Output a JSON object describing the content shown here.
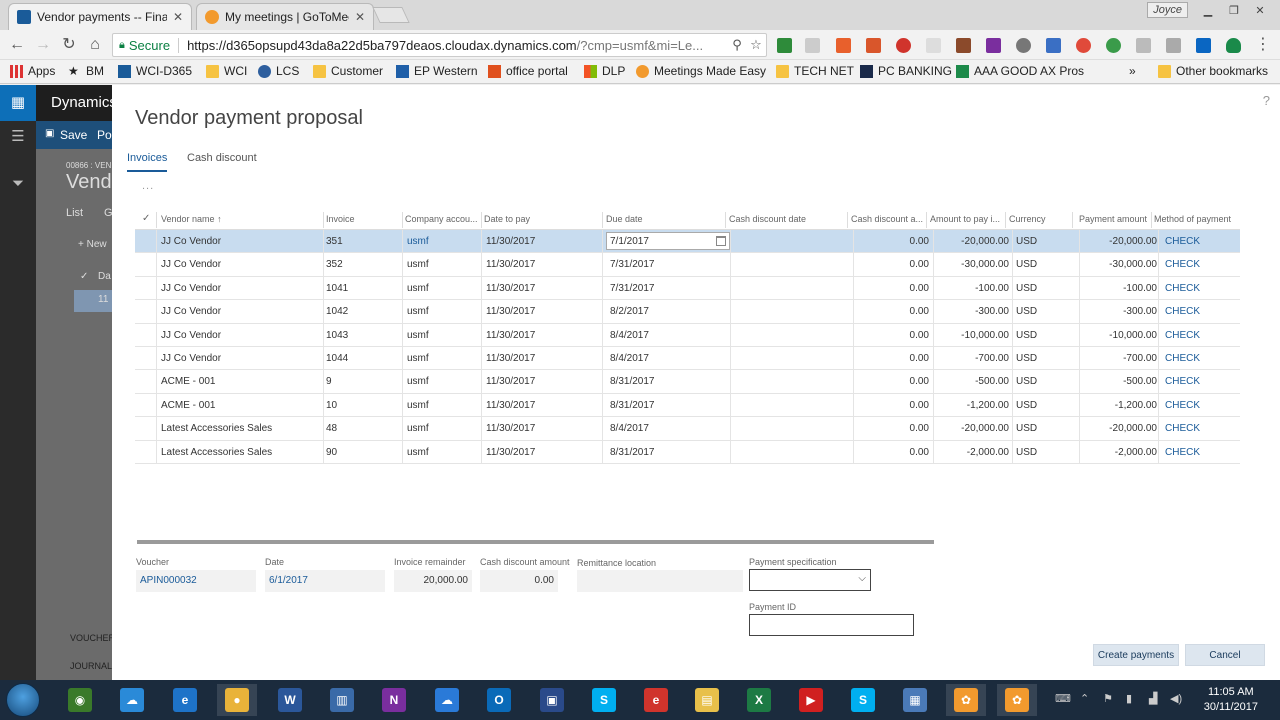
{
  "browser": {
    "tabs": [
      {
        "title": "Vendor payments -- Fina",
        "active": true
      },
      {
        "title": "My meetings | GoToMee",
        "active": false
      }
    ],
    "profile": "Joyce",
    "secure_label": "Secure",
    "url": "https://d365opsupd43da8a22d5ba797deaos.cloudax.dynamics.com",
    "url_rest": "/?cmp=usmf&mi=Le..."
  },
  "bookmarks": {
    "items": [
      "Apps",
      "BM",
      "WCI-D365",
      "WCI",
      "LCS",
      "Customer",
      "EP Western",
      "office portal",
      "DLP",
      "Meetings Made Easy",
      "TECH NET",
      "PC BANKING",
      "AAA GOOD AX Pros"
    ],
    "overflow": "»",
    "other": "Other bookmarks"
  },
  "app": {
    "name": "Dynamics",
    "save_label": "Save",
    "post_label": "Po",
    "crumb": "00866 : VEN",
    "page_title": "Vend",
    "list_tab": "List",
    "g_tab": "G",
    "new_label": "+ New",
    "da_label": "Da",
    "row_val": "11",
    "voucher_label": "VOUCHER",
    "journal_label": "JOURNAL"
  },
  "dialog": {
    "title": "Vendor payment proposal",
    "help": "?",
    "tabs": [
      "Invoices",
      "Cash discount"
    ],
    "more": "...",
    "columns": [
      "Vendor name",
      "Invoice",
      "Company accou...",
      "Date to pay",
      "Due date",
      "Cash discount date",
      "Cash discount a...",
      "Amount to pay i...",
      "Currency",
      "Payment amount",
      "Method of payment"
    ],
    "sort_indicator": "↑",
    "rows": [
      {
        "vendor": "JJ Co Vendor",
        "invoice": "351",
        "company": "usmf",
        "date_to_pay": "11/30/2017",
        "due_date": "7/1/2017",
        "cd_date": "",
        "cd_amount": "0.00",
        "amount_to_pay": "-20,000.00",
        "currency": "USD",
        "payment_amount": "-20,000.00",
        "method": "CHECK"
      },
      {
        "vendor": "JJ Co Vendor",
        "invoice": "352",
        "company": "usmf",
        "date_to_pay": "11/30/2017",
        "due_date": "7/31/2017",
        "cd_date": "",
        "cd_amount": "0.00",
        "amount_to_pay": "-30,000.00",
        "currency": "USD",
        "payment_amount": "-30,000.00",
        "method": "CHECK"
      },
      {
        "vendor": "JJ Co Vendor",
        "invoice": "1041",
        "company": "usmf",
        "date_to_pay": "11/30/2017",
        "due_date": "7/31/2017",
        "cd_date": "",
        "cd_amount": "0.00",
        "amount_to_pay": "-100.00",
        "currency": "USD",
        "payment_amount": "-100.00",
        "method": "CHECK"
      },
      {
        "vendor": "JJ Co Vendor",
        "invoice": "1042",
        "company": "usmf",
        "date_to_pay": "11/30/2017",
        "due_date": "8/2/2017",
        "cd_date": "",
        "cd_amount": "0.00",
        "amount_to_pay": "-300.00",
        "currency": "USD",
        "payment_amount": "-300.00",
        "method": "CHECK"
      },
      {
        "vendor": "JJ Co Vendor",
        "invoice": "1043",
        "company": "usmf",
        "date_to_pay": "11/30/2017",
        "due_date": "8/4/2017",
        "cd_date": "",
        "cd_amount": "0.00",
        "amount_to_pay": "-10,000.00",
        "currency": "USD",
        "payment_amount": "-10,000.00",
        "method": "CHECK"
      },
      {
        "vendor": "JJ Co Vendor",
        "invoice": "1044",
        "company": "usmf",
        "date_to_pay": "11/30/2017",
        "due_date": "8/4/2017",
        "cd_date": "",
        "cd_amount": "0.00",
        "amount_to_pay": "-700.00",
        "currency": "USD",
        "payment_amount": "-700.00",
        "method": "CHECK"
      },
      {
        "vendor": "ACME - 001",
        "invoice": "9",
        "company": "usmf",
        "date_to_pay": "11/30/2017",
        "due_date": "8/31/2017",
        "cd_date": "",
        "cd_amount": "0.00",
        "amount_to_pay": "-500.00",
        "currency": "USD",
        "payment_amount": "-500.00",
        "method": "CHECK"
      },
      {
        "vendor": "ACME - 001",
        "invoice": "10",
        "company": "usmf",
        "date_to_pay": "11/30/2017",
        "due_date": "8/31/2017",
        "cd_date": "",
        "cd_amount": "0.00",
        "amount_to_pay": "-1,200.00",
        "currency": "USD",
        "payment_amount": "-1,200.00",
        "method": "CHECK"
      },
      {
        "vendor": "Latest Accessories Sales",
        "invoice": "48",
        "company": "usmf",
        "date_to_pay": "11/30/2017",
        "due_date": "8/4/2017",
        "cd_date": "",
        "cd_amount": "0.00",
        "amount_to_pay": "-20,000.00",
        "currency": "USD",
        "payment_amount": "-20,000.00",
        "method": "CHECK"
      },
      {
        "vendor": "Latest Accessories Sales",
        "invoice": "90",
        "company": "usmf",
        "date_to_pay": "11/30/2017",
        "due_date": "8/31/2017",
        "cd_date": "",
        "cd_amount": "0.00",
        "amount_to_pay": "-2,000.00",
        "currency": "USD",
        "payment_amount": "-2,000.00",
        "method": "CHECK"
      }
    ],
    "details": {
      "voucher_label": "Voucher",
      "voucher": "APIN000032",
      "date_label": "Date",
      "date": "6/1/2017",
      "invoice_remainder_label": "Invoice remainder",
      "invoice_remainder": "20,000.00",
      "cash_discount_amount_label": "Cash discount amount",
      "cash_discount_amount": "0.00",
      "remittance_location_label": "Remittance location",
      "remittance_location": "",
      "payment_spec_label": "Payment specification",
      "payment_spec": "",
      "payment_id_label": "Payment ID",
      "payment_id": ""
    },
    "buttons": {
      "create": "Create payments",
      "cancel": "Cancel"
    }
  },
  "taskbar": {
    "apps": [
      "Mixer",
      "OneDrive",
      "Internet Explorer",
      "Chrome",
      "Word",
      "Books",
      "OneNote",
      "Azure",
      "Outlook",
      "Network",
      "Skype",
      "Expensify",
      "File Explorer",
      "Excel",
      "YouTube",
      "Skype for Business",
      "Remote Desktop",
      "GoToMeeting",
      "GoToMeeting"
    ],
    "time": "11:05 AM",
    "date": "30/11/2017"
  },
  "colors": {
    "accent": "#1a5b99",
    "selected_row": "#c8dcef",
    "taskbar": "#1b2b3d",
    "nav_dark": "#1e1e1e"
  }
}
